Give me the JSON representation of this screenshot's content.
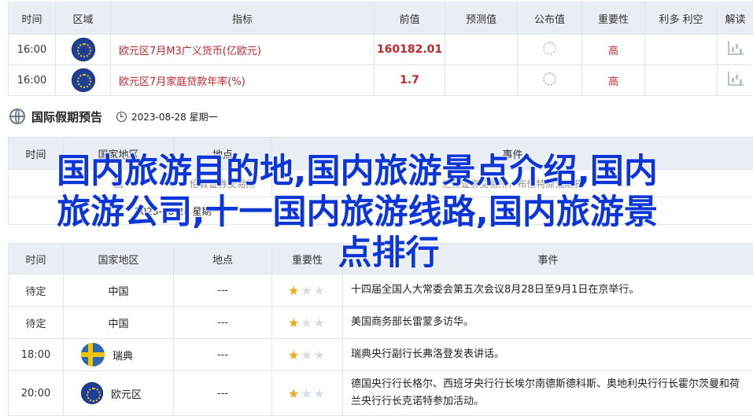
{
  "top_table": {
    "headers": [
      "时间",
      "区域",
      "指标",
      "前值",
      "预测值",
      "公布值",
      "重要性",
      "利多 利空",
      "解读"
    ],
    "rows": [
      {
        "time": "16:00",
        "indicator": "欧元区7月M3广义货币(亿欧元)",
        "previous": "160182.01",
        "importance": "高"
      },
      {
        "time": "16:00",
        "indicator": "欧元区7月家庭贷款年率(%)",
        "previous": "1.7",
        "importance": "高"
      }
    ]
  },
  "holiday": {
    "title": "国际假期预告",
    "date": "2023-08-28 星期一",
    "headers": [
      "时间",
      "国家地区",
      "地点",
      "事件"
    ],
    "row1": {
      "time_partial": "",
      "region_partial": "国",
      "location_partial": "伦敦证券交易所",
      "event_partial": "伦敦证券交易所，布伦特原油期货"
    },
    "row2_date": "2023-08-28 星期一"
  },
  "events_table": {
    "headers": [
      "时间",
      "国家地区",
      "地点",
      "重要性",
      "事件"
    ],
    "rows": [
      {
        "time": "待定",
        "country": "中国",
        "location": "---",
        "stars": 1,
        "event": "十四届全国人大常委会第五次会议8月28日至9月1日在京举行。"
      },
      {
        "time": "待定",
        "country": "中国",
        "location": "---",
        "stars": 1,
        "event": "美国商务部长雷蒙多访华。"
      },
      {
        "time": "18:00",
        "country": "瑞典",
        "location": "---",
        "stars": 1,
        "event": "瑞典央行副行长弗洛登发表讲话。"
      },
      {
        "time": "20:00",
        "country": "欧元区",
        "location": "---",
        "stars": 1,
        "event": "德国央行行长格尔、西班牙央行行长埃尔南德斯德科斯、奥地利央行行长霍尔茨曼和荷兰央行行长克诺特参加活动。"
      }
    ]
  },
  "overlay": {
    "line1": "国内旅游目的地,国内旅游景点介绍,国内",
    "line2": "旅游公司,十一国内旅游线路,国内旅游景",
    "line3": "点排行"
  },
  "colors": {
    "accent_red": "#c0262d",
    "overlay_blue": "#0d36d6",
    "header_bg": "#e9eef5",
    "star_on": "#f0a718"
  }
}
